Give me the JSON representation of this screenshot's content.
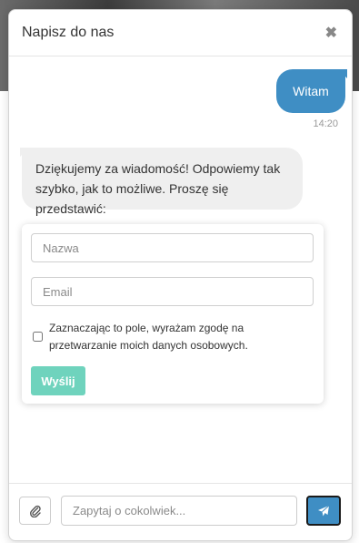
{
  "header": {
    "title": "Napisz do nas",
    "close_icon": "close-icon"
  },
  "conversation": {
    "user_message": {
      "text": "Witam",
      "time": "14:20"
    },
    "bot_message": {
      "text": "Dziękujemy za wiadomość! Odpowiemy tak szybko, jak to możliwe. Proszę się przedstawić:"
    }
  },
  "contact_form": {
    "name_placeholder": "Nazwa",
    "email_placeholder": "Email",
    "consent_label": "Zaznaczając to pole, wyrażam zgodę na przetwarzanie moich danych osobowych.",
    "submit_label": "Wyślij"
  },
  "composer": {
    "placeholder": "Zapytaj o cokolwiek...",
    "attach_icon": "paperclip-icon",
    "send_icon": "paper-plane-icon"
  },
  "colors": {
    "accent": "#3f8ec4",
    "submit_button": "#6fd3bd",
    "bot_bubble": "#efefef"
  }
}
